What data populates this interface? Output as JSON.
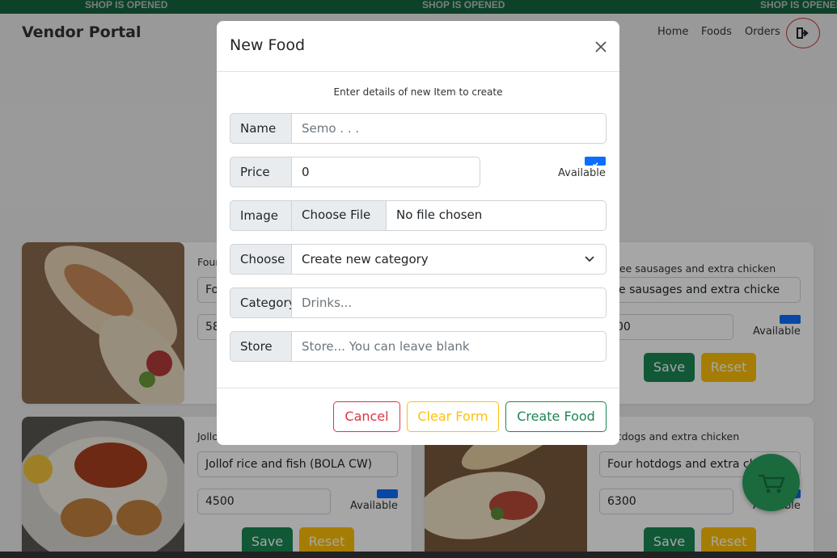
{
  "marquee": {
    "text": "SHOP IS OPENED"
  },
  "header": {
    "brand": "Vendor Portal",
    "nav": [
      "Home",
      "Foods",
      "Orders"
    ]
  },
  "cards": [
    {
      "title": "Four",
      "name_value": "Fo",
      "price_value": "58",
      "available_label": "Available",
      "save_label": "Save",
      "reset_label": "Reset"
    },
    {
      "title": "ree sausages and extra chicken",
      "name_value": "ree sausages and extra chicke",
      "price_value": "00",
      "available_label": "Available",
      "save_label": "Save",
      "reset_label": "Reset"
    },
    {
      "title": "Jollo",
      "name_value": "Jollof rice and fish (BOLA CW)",
      "price_value": "4500",
      "available_label": "Available",
      "save_label": "Save",
      "reset_label": "Reset"
    },
    {
      "title": "r hotdogs and extra chicken",
      "name_value": "Four hotdogs and extra ch",
      "price_value": "6300",
      "available_label": "Available",
      "save_label": "Save",
      "reset_label": "Reset"
    }
  ],
  "modal": {
    "title": "New Food",
    "intro": "Enter details of new Item to create",
    "name": {
      "label": "Name",
      "placeholder": "Semo . . ."
    },
    "price": {
      "label": "Price",
      "value": "0"
    },
    "available_label": "Available",
    "image": {
      "label": "Image",
      "button": "Choose File",
      "status": "No file chosen"
    },
    "choose": {
      "label": "Choose",
      "selected": "Create new category"
    },
    "category": {
      "label": "Category",
      "placeholder": "Drinks..."
    },
    "store": {
      "label": "Store",
      "placeholder": "Store... You can leave blank"
    },
    "buttons": {
      "cancel": "Cancel",
      "clear": "Clear Form",
      "create": "Create Food"
    }
  },
  "colors": {
    "marquee_bg": "#15663f",
    "save": "#198754",
    "reset": "#ffc107",
    "cancel": "#dc3545",
    "clear": "#ffc107",
    "create": "#198754",
    "checkbox": "#0d6efd"
  },
  "icons": [
    "logout-icon",
    "close-icon",
    "chevron-down-icon",
    "check-icon",
    "cart-icon"
  ]
}
